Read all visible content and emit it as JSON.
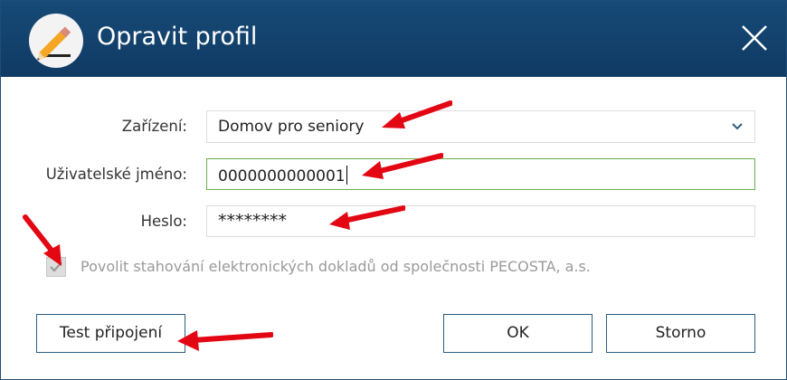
{
  "window": {
    "title": "Opravit profil",
    "title_bar_color": "#144572",
    "app_icon": "pencil-icon",
    "close_icon": "close-icon"
  },
  "form": {
    "device": {
      "label": "Zařízení:",
      "value": "Domov pro seniory",
      "icon": "chevron-down-icon"
    },
    "username": {
      "label": "Uživatelské jméno:",
      "value": "0000000000001",
      "focus_border_color": "#6ab04c"
    },
    "password": {
      "label": "Heslo:",
      "value": "********"
    },
    "download_docs": {
      "label": "Povolit stahování elektronických dokladů od společnosti PECOSTA, a.s.",
      "checked": true,
      "disabled": true
    }
  },
  "buttons": {
    "test_connection": "Test připojení",
    "ok": "OK",
    "cancel": "Storno"
  },
  "annotations": {
    "arrow_color": "#e30613",
    "arrow_icon": "red-arrow-icon"
  }
}
